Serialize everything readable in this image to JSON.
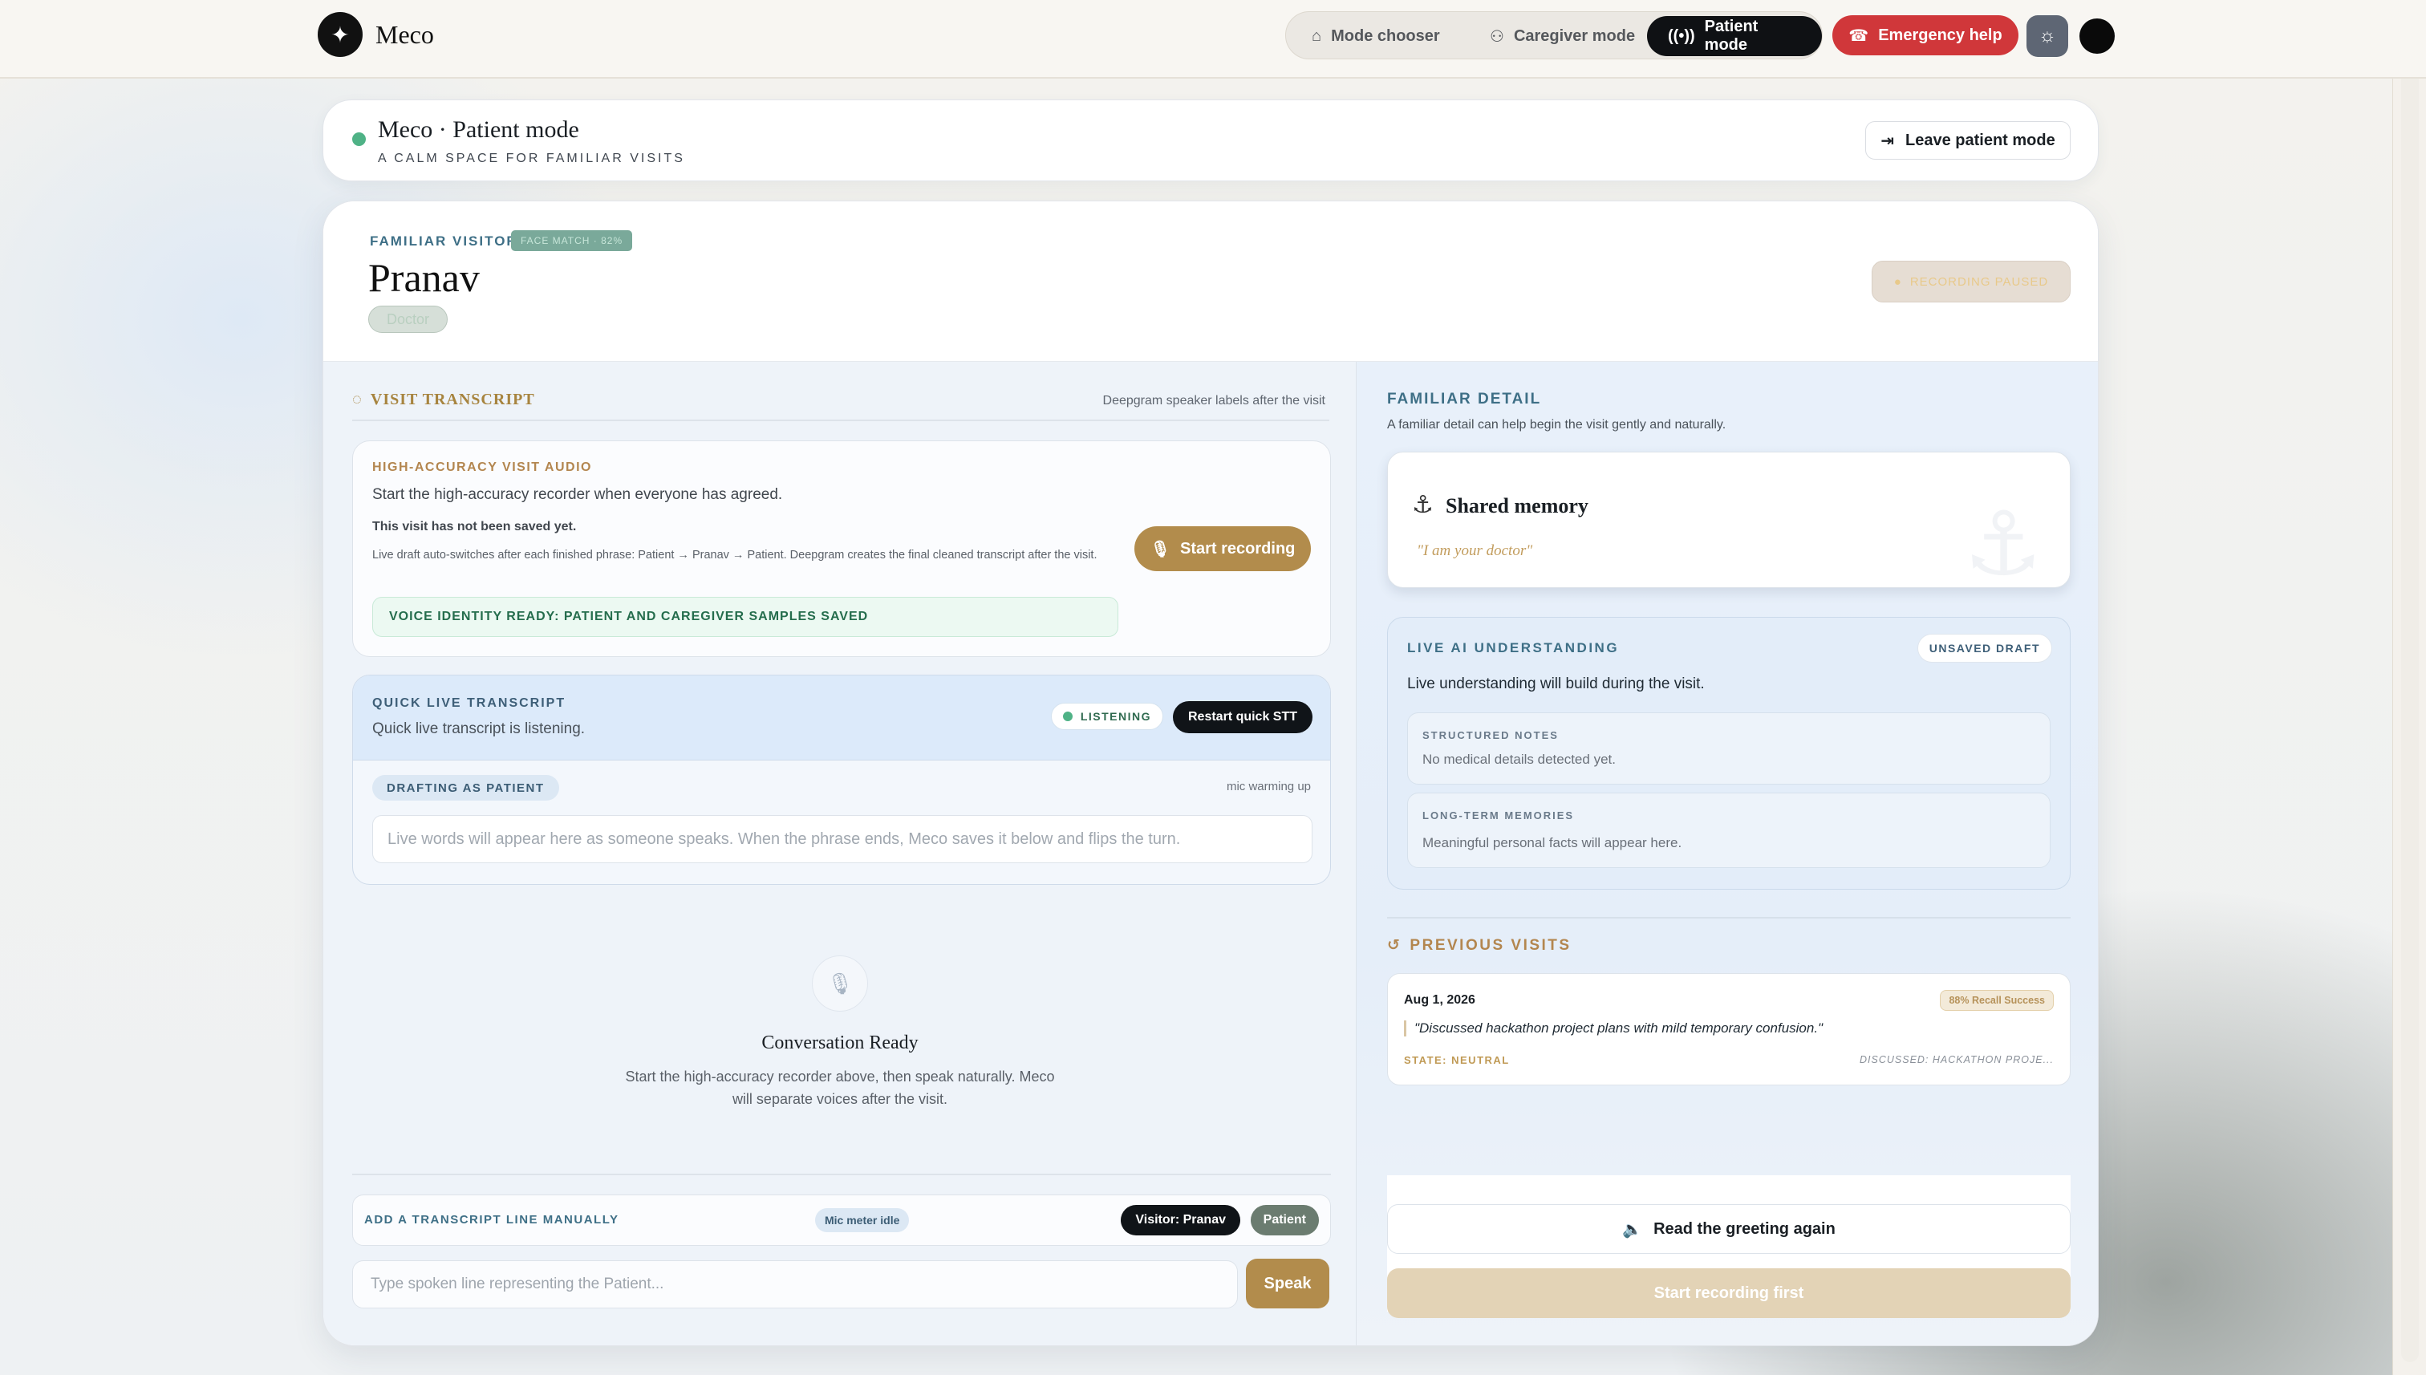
{
  "app": {
    "name": "Meco",
    "logo_glyph": "✦"
  },
  "nav": {
    "items": [
      {
        "label": "Mode chooser",
        "icon": "home-icon"
      },
      {
        "label": "Caregiver mode",
        "icon": "users-icon"
      },
      {
        "label": "Patient mode",
        "icon": "broadcast-icon",
        "active": true
      }
    ],
    "emergency_label": "Emergency help"
  },
  "header": {
    "title": "Meco · Patient mode",
    "subtitle": "A CALM SPACE FOR FAMILIAR VISITS",
    "leave_label": "Leave patient mode"
  },
  "visitor": {
    "label": "FAMILIAR VISITOR",
    "face_badge": "FACE MATCH · 82%",
    "name": "Pranav",
    "role": "Doctor",
    "recording_badge": "RECORDING PAUSED"
  },
  "transcript": {
    "title": "VISIT TRANSCRIPT",
    "note": "Deepgram speaker labels after the visit",
    "audio": {
      "label": "HIGH-ACCURACY VISIT AUDIO",
      "text": "Start the high-accuracy recorder when everyone has agreed.",
      "not_saved": "This visit has not been saved yet.",
      "explainer": "Live draft auto-switches after each finished phrase: Patient → Pranav → Patient. Deepgram creates the final cleaned transcript after the visit.",
      "voice_ready": "VOICE IDENTITY READY: PATIENT AND CAREGIVER SAMPLES SAVED",
      "start_label": "Start recording"
    },
    "quick": {
      "label": "QUICK LIVE TRANSCRIPT",
      "sub": "Quick live transcript is listening.",
      "listening": "LISTENING",
      "restart_label": "Restart quick STT",
      "drafting": "DRAFTING AS PATIENT",
      "mic_status": "mic warming up",
      "placeholder": "Live words will appear here as someone speaks. When the phrase ends, Meco saves it below and flips the turn."
    },
    "ready": {
      "title": "Conversation Ready",
      "desc": "Start the high-accuracy recorder above, then speak naturally. Meco will separate voices after the visit."
    },
    "manual": {
      "label": "ADD A TRANSCRIPT LINE MANUALLY",
      "mic_meter": "Mic meter idle",
      "visitor_btn": "Visitor: Pranav",
      "patient_btn": "Patient",
      "placeholder": "Type spoken line representing the Patient...",
      "speak_label": "Speak"
    }
  },
  "familiar": {
    "label": "FAMILIAR DETAIL",
    "sub": "A familiar detail can help begin the visit gently and naturally.",
    "memory_title": "Shared memory",
    "memory_quote": "\"I am your doctor\""
  },
  "ai": {
    "label": "LIVE AI UNDERSTANDING",
    "badge": "UNSAVED DRAFT",
    "text": "Live understanding will build during the visit.",
    "notes_label": "STRUCTURED NOTES",
    "notes_text": "No medical details detected yet.",
    "memories_label": "LONG-TERM MEMORIES",
    "memories_text": "Meaningful personal facts will appear here."
  },
  "previous": {
    "label": "PREVIOUS VISITS",
    "visits": [
      {
        "date": "Aug 1, 2026",
        "recall": "88% Recall Success",
        "quote": "\"Discussed hackathon project plans with mild temporary confusion.\"",
        "state": "STATE: NEUTRAL",
        "discussed": "DISCUSSED: HACKATHON PROJE..."
      }
    ]
  },
  "actions": {
    "greeting_label": "Read the greeting again",
    "start_first_label": "Start recording first"
  },
  "colors": {
    "accent_gold": "#b28c4c",
    "emergency_red": "#d0373a",
    "status_green": "#4fb286",
    "teal_label": "#3e6f86"
  }
}
